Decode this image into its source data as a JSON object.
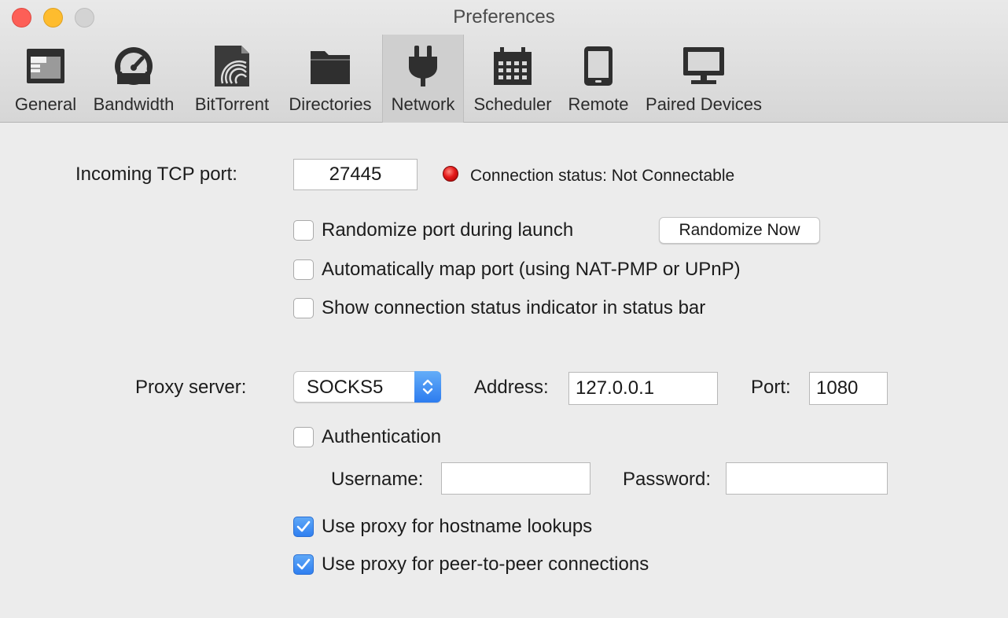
{
  "window": {
    "title": "Preferences"
  },
  "toolbar": {
    "tabs": [
      {
        "label": "General",
        "icon": "general-window-icon",
        "selected": false
      },
      {
        "label": "Bandwidth",
        "icon": "gauge-icon",
        "selected": false
      },
      {
        "label": "BitTorrent",
        "icon": "bittorrent-document-icon",
        "selected": false
      },
      {
        "label": "Directories",
        "icon": "folder-icon",
        "selected": false
      },
      {
        "label": "Network",
        "icon": "plug-icon",
        "selected": true
      },
      {
        "label": "Scheduler",
        "icon": "calendar-icon",
        "selected": false
      },
      {
        "label": "Remote",
        "icon": "phone-icon",
        "selected": false
      },
      {
        "label": "Paired Devices",
        "icon": "monitor-icon",
        "selected": false
      }
    ]
  },
  "network": {
    "incoming_port_label": "Incoming TCP port:",
    "incoming_port_value": "27445",
    "connection_status": "Connection status: Not Connectable",
    "status_color": "#e51a1a",
    "randomize_port_label": "Randomize port during launch",
    "randomize_port_checked": false,
    "randomize_now_button": "Randomize Now",
    "auto_map_label": "Automatically map port (using NAT-PMP or UPnP)",
    "auto_map_checked": false,
    "show_indicator_label": "Show connection status indicator in status bar",
    "show_indicator_checked": false
  },
  "proxy": {
    "server_label": "Proxy server:",
    "type_selected": "SOCKS5",
    "address_label": "Address:",
    "address_value": "127.0.0.1",
    "port_label": "Port:",
    "port_value": "1080",
    "authentication_label": "Authentication",
    "authentication_checked": false,
    "username_label": "Username:",
    "username_value": "",
    "password_label": "Password:",
    "password_value": "",
    "hostname_lookups_label": "Use proxy for hostname lookups",
    "hostname_lookups_checked": true,
    "peer_connections_label": "Use proxy for peer-to-peer connections",
    "peer_connections_checked": true
  },
  "colors": {
    "accent": "#2f7ff0",
    "window_bg": "#ececec"
  }
}
